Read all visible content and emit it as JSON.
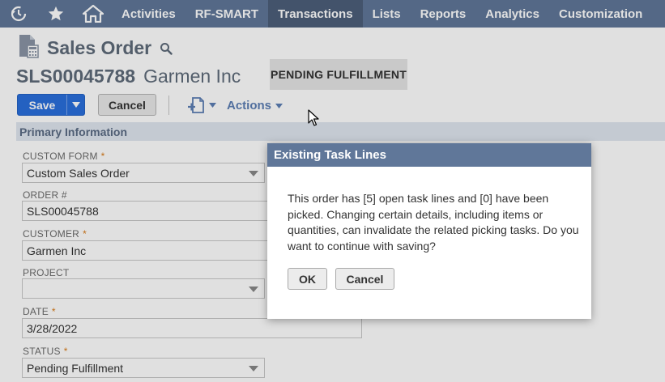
{
  "nav": {
    "icons": [
      "recent-history-icon",
      "star-icon",
      "home-icon"
    ],
    "items": [
      {
        "label": "Activities",
        "active": false
      },
      {
        "label": "RF-SMART",
        "active": false
      },
      {
        "label": "Transactions",
        "active": true
      },
      {
        "label": "Lists",
        "active": false
      },
      {
        "label": "Reports",
        "active": false
      },
      {
        "label": "Analytics",
        "active": false
      },
      {
        "label": "Customization",
        "active": false
      }
    ]
  },
  "header": {
    "page_title": "Sales Order",
    "record_number": "SLS00045788",
    "customer_name": "Garmen Inc",
    "status": "PENDING FULFILLMENT"
  },
  "toolbar": {
    "save_label": "Save",
    "cancel_label": "Cancel",
    "actions_label": "Actions"
  },
  "section": {
    "title": "Primary Information"
  },
  "fields": {
    "custom_form": {
      "label": "CUSTOM FORM",
      "value": "Custom Sales Order",
      "required": true
    },
    "order_number": {
      "label": "ORDER #",
      "value": "SLS00045788",
      "required": false
    },
    "customer": {
      "label": "CUSTOMER",
      "value": "Garmen Inc",
      "required": true
    },
    "project": {
      "label": "PROJECT",
      "value": "",
      "required": false
    },
    "date": {
      "label": "DATE",
      "value": "3/28/2022",
      "required": true
    },
    "status": {
      "label": "STATUS",
      "value": "Pending Fulfillment",
      "required": true
    }
  },
  "required_marker": "*",
  "modal": {
    "title": "Existing Task Lines",
    "message": "This order has [5] open task lines and [0] have been picked. Changing certain details, including items or quantities, can invalidate the related picking tasks. Do you want to continue with saving?",
    "ok_label": "OK",
    "cancel_label": "Cancel"
  },
  "colors": {
    "nav_bg": "#607799",
    "nav_active": "#4d5f7a",
    "save_blue": "#2a6fdc",
    "section_bg": "#e0e6ef",
    "required_orange": "#d97c1a"
  }
}
